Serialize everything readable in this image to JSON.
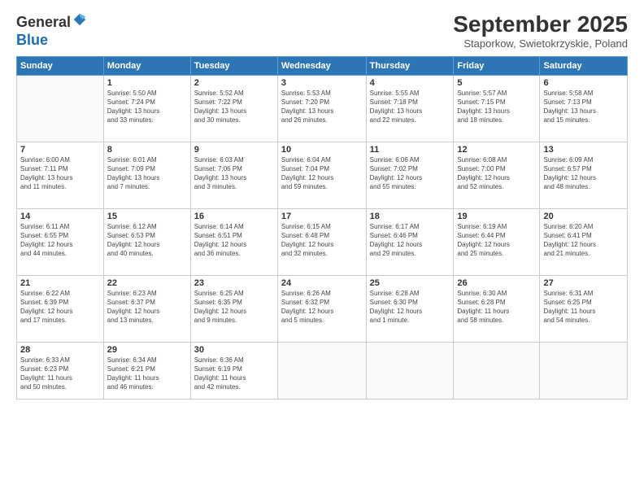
{
  "header": {
    "logo_general": "General",
    "logo_blue": "Blue",
    "month_title": "September 2025",
    "location": "Staporkow, Swietokrzyskie, Poland"
  },
  "days_of_week": [
    "Sunday",
    "Monday",
    "Tuesday",
    "Wednesday",
    "Thursday",
    "Friday",
    "Saturday"
  ],
  "weeks": [
    [
      {
        "day": "",
        "info": ""
      },
      {
        "day": "1",
        "info": "Sunrise: 5:50 AM\nSunset: 7:24 PM\nDaylight: 13 hours\nand 33 minutes."
      },
      {
        "day": "2",
        "info": "Sunrise: 5:52 AM\nSunset: 7:22 PM\nDaylight: 13 hours\nand 30 minutes."
      },
      {
        "day": "3",
        "info": "Sunrise: 5:53 AM\nSunset: 7:20 PM\nDaylight: 13 hours\nand 26 minutes."
      },
      {
        "day": "4",
        "info": "Sunrise: 5:55 AM\nSunset: 7:18 PM\nDaylight: 13 hours\nand 22 minutes."
      },
      {
        "day": "5",
        "info": "Sunrise: 5:57 AM\nSunset: 7:15 PM\nDaylight: 13 hours\nand 18 minutes."
      },
      {
        "day": "6",
        "info": "Sunrise: 5:58 AM\nSunset: 7:13 PM\nDaylight: 13 hours\nand 15 minutes."
      }
    ],
    [
      {
        "day": "7",
        "info": "Sunrise: 6:00 AM\nSunset: 7:11 PM\nDaylight: 13 hours\nand 11 minutes."
      },
      {
        "day": "8",
        "info": "Sunrise: 6:01 AM\nSunset: 7:09 PM\nDaylight: 13 hours\nand 7 minutes."
      },
      {
        "day": "9",
        "info": "Sunrise: 6:03 AM\nSunset: 7:06 PM\nDaylight: 13 hours\nand 3 minutes."
      },
      {
        "day": "10",
        "info": "Sunrise: 6:04 AM\nSunset: 7:04 PM\nDaylight: 12 hours\nand 59 minutes."
      },
      {
        "day": "11",
        "info": "Sunrise: 6:06 AM\nSunset: 7:02 PM\nDaylight: 12 hours\nand 55 minutes."
      },
      {
        "day": "12",
        "info": "Sunrise: 6:08 AM\nSunset: 7:00 PM\nDaylight: 12 hours\nand 52 minutes."
      },
      {
        "day": "13",
        "info": "Sunrise: 6:09 AM\nSunset: 6:57 PM\nDaylight: 12 hours\nand 48 minutes."
      }
    ],
    [
      {
        "day": "14",
        "info": "Sunrise: 6:11 AM\nSunset: 6:55 PM\nDaylight: 12 hours\nand 44 minutes."
      },
      {
        "day": "15",
        "info": "Sunrise: 6:12 AM\nSunset: 6:53 PM\nDaylight: 12 hours\nand 40 minutes."
      },
      {
        "day": "16",
        "info": "Sunrise: 6:14 AM\nSunset: 6:51 PM\nDaylight: 12 hours\nand 36 minutes."
      },
      {
        "day": "17",
        "info": "Sunrise: 6:15 AM\nSunset: 6:48 PM\nDaylight: 12 hours\nand 32 minutes."
      },
      {
        "day": "18",
        "info": "Sunrise: 6:17 AM\nSunset: 6:46 PM\nDaylight: 12 hours\nand 29 minutes."
      },
      {
        "day": "19",
        "info": "Sunrise: 6:19 AM\nSunset: 6:44 PM\nDaylight: 12 hours\nand 25 minutes."
      },
      {
        "day": "20",
        "info": "Sunrise: 6:20 AM\nSunset: 6:41 PM\nDaylight: 12 hours\nand 21 minutes."
      }
    ],
    [
      {
        "day": "21",
        "info": "Sunrise: 6:22 AM\nSunset: 6:39 PM\nDaylight: 12 hours\nand 17 minutes."
      },
      {
        "day": "22",
        "info": "Sunrise: 6:23 AM\nSunset: 6:37 PM\nDaylight: 12 hours\nand 13 minutes."
      },
      {
        "day": "23",
        "info": "Sunrise: 6:25 AM\nSunset: 6:35 PM\nDaylight: 12 hours\nand 9 minutes."
      },
      {
        "day": "24",
        "info": "Sunrise: 6:26 AM\nSunset: 6:32 PM\nDaylight: 12 hours\nand 5 minutes."
      },
      {
        "day": "25",
        "info": "Sunrise: 6:28 AM\nSunset: 6:30 PM\nDaylight: 12 hours\nand 1 minute."
      },
      {
        "day": "26",
        "info": "Sunrise: 6:30 AM\nSunset: 6:28 PM\nDaylight: 11 hours\nand 58 minutes."
      },
      {
        "day": "27",
        "info": "Sunrise: 6:31 AM\nSunset: 6:25 PM\nDaylight: 11 hours\nand 54 minutes."
      }
    ],
    [
      {
        "day": "28",
        "info": "Sunrise: 6:33 AM\nSunset: 6:23 PM\nDaylight: 11 hours\nand 50 minutes."
      },
      {
        "day": "29",
        "info": "Sunrise: 6:34 AM\nSunset: 6:21 PM\nDaylight: 11 hours\nand 46 minutes."
      },
      {
        "day": "30",
        "info": "Sunrise: 6:36 AM\nSunset: 6:19 PM\nDaylight: 11 hours\nand 42 minutes."
      },
      {
        "day": "",
        "info": ""
      },
      {
        "day": "",
        "info": ""
      },
      {
        "day": "",
        "info": ""
      },
      {
        "day": "",
        "info": ""
      }
    ]
  ]
}
